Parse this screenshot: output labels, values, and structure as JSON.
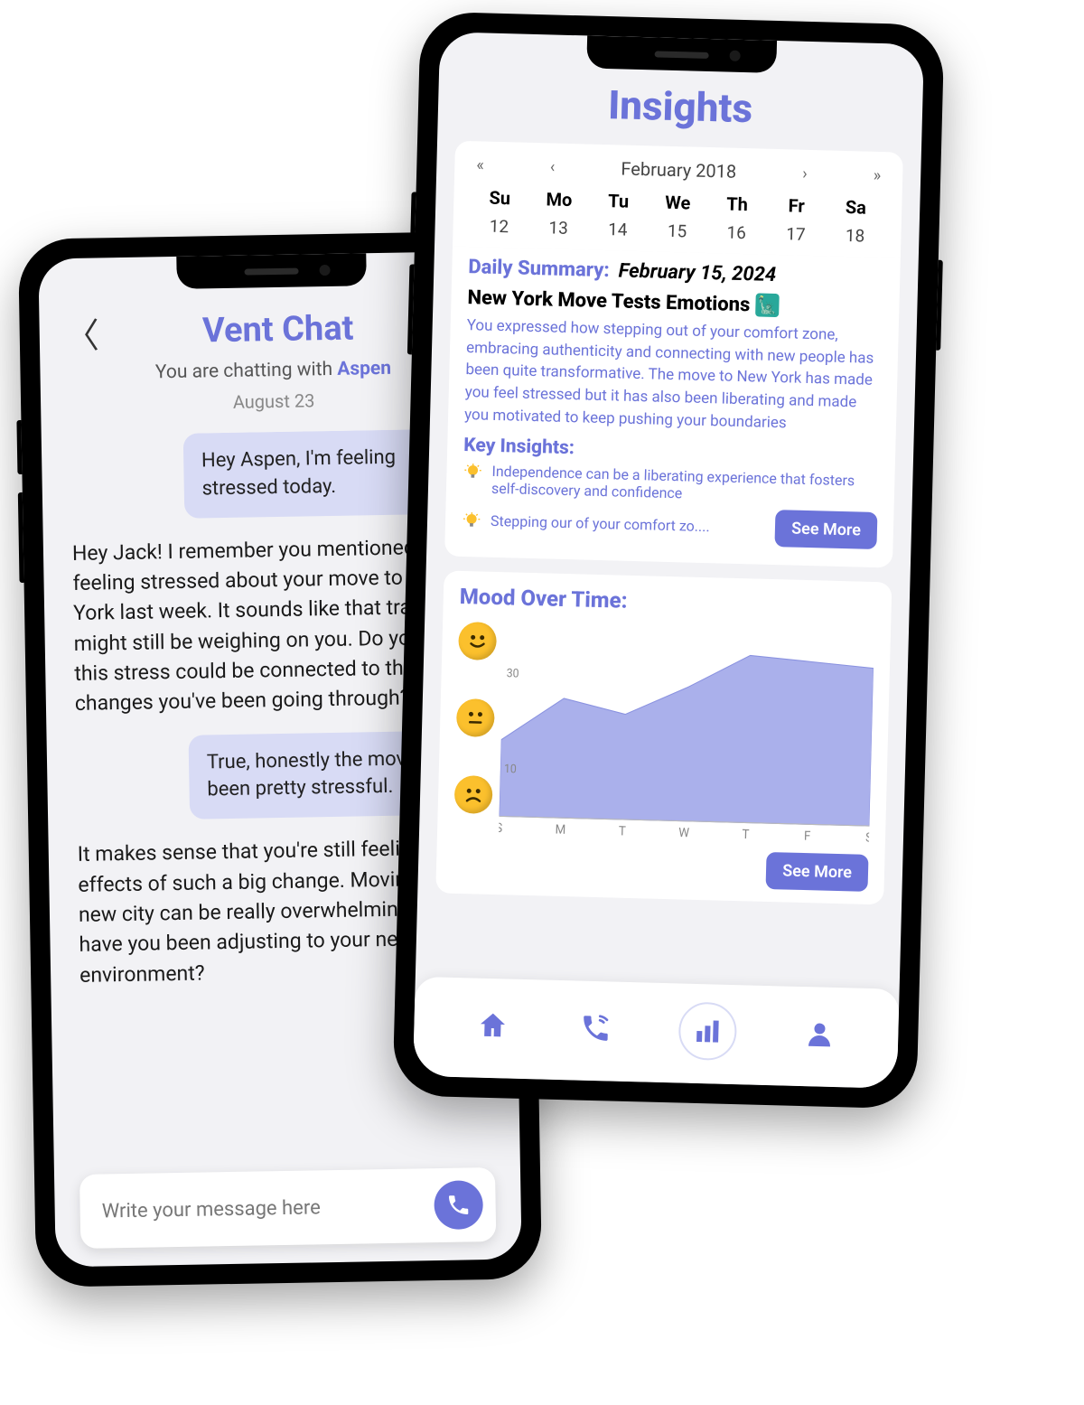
{
  "chat": {
    "title": "Vent Chat",
    "subtitle_prefix": "You are chatting with ",
    "chat_with": "Aspen",
    "date": "August 23",
    "messages": [
      {
        "role": "user",
        "text": "Hey Aspen, I'm feeling stressed today."
      },
      {
        "role": "bot",
        "text": "Hey Jack! I remember you mentioned feeling stressed about your move to New York last week. It sounds like that transition might still be weighing on you. Do you think this stress could be connected to the changes you've been going through?"
      },
      {
        "role": "user",
        "text": "True, honestly the move has been pretty stressful."
      },
      {
        "role": "bot",
        "text": "It makes sense that you're still feeling the effects of such a big change. Moving to a new city can be really overwhelming. How have you been adjusting to your new environment?"
      }
    ],
    "input_placeholder": "Write your message here"
  },
  "insights": {
    "title": "Insights",
    "calendar": {
      "month_label": "February 2018",
      "nav": {
        "first": "«",
        "prev": "‹",
        "next": "›",
        "last": "»"
      },
      "dow": [
        "Su",
        "Mo",
        "Tu",
        "We",
        "Th",
        "Fr",
        "Sa"
      ],
      "days": [
        "12",
        "13",
        "14",
        "15",
        "16",
        "17",
        "18"
      ]
    },
    "summary": {
      "label": "Daily Summary:",
      "date": "February 15, 2024",
      "headline": "New York Move Tests Emotions",
      "body": "You expressed how stepping out of your comfort zone, embracing authenticity and connecting with new people has been quite transformative. The move to New York has made you feel stressed but it has also been liberating and made you motivated to keep pushing your boundaries",
      "key_label": "Key Insights:",
      "insights": [
        "Independence can be a liberating experience that fosters self-discovery and confidence",
        "Stepping our of your comfort zo...."
      ],
      "see_more": "See More"
    },
    "mood": {
      "title": "Mood Over Time:",
      "see_more": "See More"
    },
    "nav_items": [
      "home",
      "phone",
      "insights",
      "profile"
    ]
  },
  "chart_data": {
    "type": "area",
    "title": "Mood Over Time:",
    "xlabel": "",
    "ylabel": "",
    "categories": [
      "S",
      "M",
      "T",
      "W",
      "T",
      "F",
      "S"
    ],
    "values": [
      16,
      25,
      22,
      28,
      35,
      34,
      33
    ],
    "ylim": [
      0,
      40
    ],
    "yticks": [
      10,
      30
    ],
    "y_emoji_scale": [
      "sad",
      "neutral",
      "happy"
    ]
  }
}
